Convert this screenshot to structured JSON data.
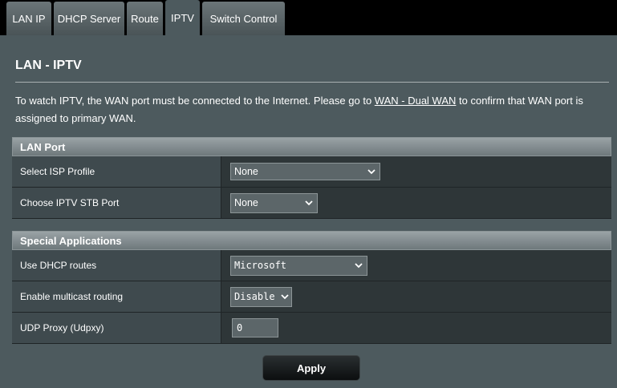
{
  "tabs": [
    {
      "label": "LAN IP"
    },
    {
      "label": "DHCP Server"
    },
    {
      "label": "Route"
    },
    {
      "label": "IPTV"
    },
    {
      "label": "Switch Control"
    }
  ],
  "active_tab": "IPTV",
  "page": {
    "title": "LAN - IPTV",
    "desc_before": "To watch IPTV, the WAN port must be connected to the Internet. Please go to ",
    "desc_link": "WAN - Dual WAN",
    "desc_after": " to confirm that WAN port is assigned to primary WAN."
  },
  "lan_port": {
    "header": "LAN Port",
    "isp_profile": {
      "label": "Select ISP Profile",
      "value": "None"
    },
    "stb_port": {
      "label": "Choose IPTV STB Port",
      "value": "None"
    }
  },
  "special_apps": {
    "header": "Special Applications",
    "dhcp_routes": {
      "label": "Use DHCP routes",
      "value": "Microsoft"
    },
    "multicast": {
      "label": "Enable multicast routing",
      "value": "Disable"
    },
    "udpxy": {
      "label": "UDP Proxy (Udpxy)",
      "value": "0"
    }
  },
  "apply_label": "Apply",
  "icons": {
    "dropdown": "chevron-down-icon"
  }
}
